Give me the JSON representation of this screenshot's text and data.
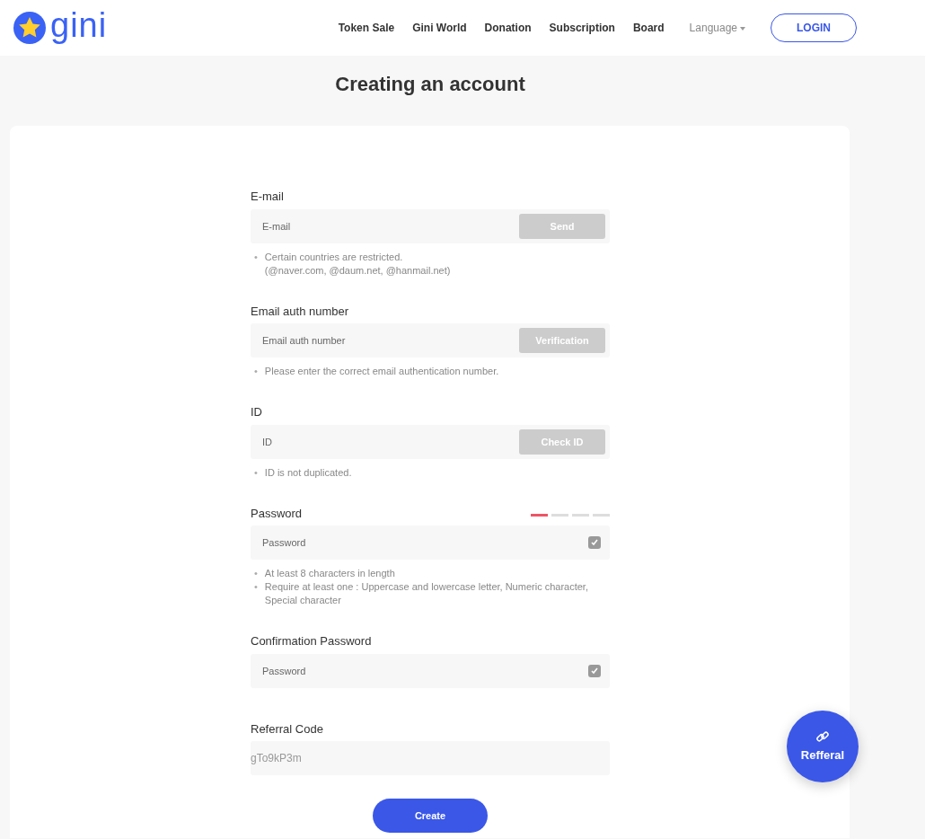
{
  "header": {
    "logo": "gini",
    "nav": [
      {
        "label": "Token Sale"
      },
      {
        "label": "Gini World"
      },
      {
        "label": "Donation"
      },
      {
        "label": "Subscription"
      },
      {
        "label": "Board"
      }
    ],
    "language": "Language",
    "login": "LOGIN"
  },
  "title": "Creating an account",
  "fields": [
    {
      "kind": "button",
      "label": "E-mail",
      "placeholder": "E-mail",
      "button": "Send",
      "bullet": "•",
      "hints": [
        "Certain countries are restricted.\n(@naver.com, @daum.net, @hanmail.net)"
      ]
    },
    {
      "kind": "button",
      "label": "Email auth number",
      "placeholder": "Email auth number",
      "button": "Verification",
      "bullet": "•",
      "hints": [
        "Please enter the correct email authentication number."
      ]
    },
    {
      "kind": "button",
      "label": "ID",
      "placeholder": "ID",
      "button": "Check ID",
      "bullet": "•",
      "hints": [
        "ID is not duplicated."
      ]
    },
    {
      "kind": "check",
      "label": "Password",
      "placeholder": "Password",
      "strength": {
        "level": 0.25
      },
      "bullet": "•",
      "hints": [
        "At least 8 characters in length",
        "Require at least one : Uppercase and lowercase letter, Numeric character, Special character"
      ]
    },
    {
      "kind": "check",
      "label": "Confirmation Password",
      "placeholder": "Password"
    },
    {
      "kind": "plain",
      "label": "Referral Code",
      "value": "gTo9kP3m"
    }
  ],
  "create": "Create",
  "referral_button": "Refferal"
}
